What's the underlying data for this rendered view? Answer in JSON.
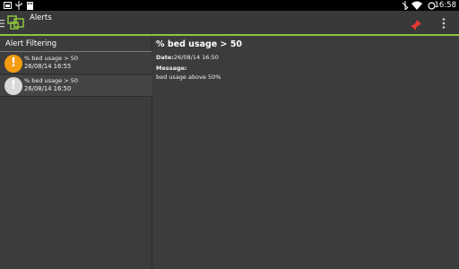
{
  "status_bar": {
    "time": "16:58",
    "left_icons": [
      "screenshot-icon",
      "usb-icon",
      "sd-card-icon"
    ],
    "right_icons": [
      "bluetooth-off-icon",
      "wifi-icon",
      "battery-icon"
    ]
  },
  "action_bar": {
    "title": "Alerts",
    "app_icon": "app-logo-icon",
    "actions": [
      "pin-icon",
      "overflow-menu-icon"
    ],
    "accent_color": "#8cc43f"
  },
  "left_pane": {
    "header": "Alert Filtering",
    "alerts": [
      {
        "title": "% bed usage > 50",
        "timestamp": "26/08/14 16:55",
        "severity": "warning",
        "icon_color": "#f39c12"
      },
      {
        "title": "% bed usage > 50",
        "timestamp": "26/08/14 16:50",
        "severity": "info",
        "icon_color": "#d8d8d8"
      }
    ]
  },
  "detail": {
    "title": "% bed usage > 50",
    "date_label": "Date:",
    "date_value": "26/08/14 16:50",
    "message_label": "Message:",
    "message_value": "bed usage above 50%"
  }
}
